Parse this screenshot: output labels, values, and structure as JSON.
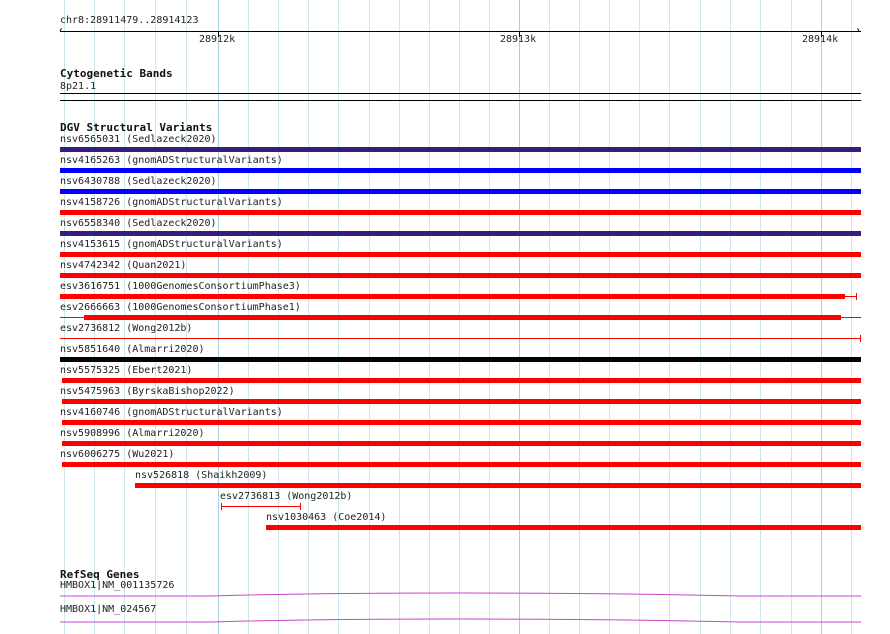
{
  "ruler": {
    "location": "chr8:28911479..28914123",
    "ticks": [
      "28912k",
      "28913k",
      "28914k"
    ]
  },
  "cytobands": {
    "title": "Cytogenetic Bands",
    "band": "8p21.1"
  },
  "dgv": {
    "title": "DGV Structural Variants",
    "colors": {
      "purple": "#3a1c7a",
      "blue": "#0000ff",
      "red": "#ff0000",
      "black": "#000000"
    },
    "variants": [
      {
        "label": "nsv6565031 (Sedlazeck2020)",
        "color": "#3a1c7a"
      },
      {
        "label": "nsv4165263 (gnomADStructuralVariants)",
        "color": "#0000ff"
      },
      {
        "label": "nsv6430788 (Sedlazeck2020)",
        "color": "#0000ff"
      },
      {
        "label": "nsv4158726 (gnomADStructuralVariants)",
        "color": "#ff0000"
      },
      {
        "label": "nsv6558340 (Sedlazeck2020)",
        "color": "#3a1c7a"
      },
      {
        "label": "nsv4153615 (gnomADStructuralVariants)",
        "color": "#ff0000"
      },
      {
        "label": "nsv4742342 (Quan2021)",
        "color": "#ff0000"
      },
      {
        "label": "esv3616751 (1000GenomesConsortiumPhase3)",
        "color": "#ff0000"
      },
      {
        "label": "esv2666663 (1000GenomesConsortiumPhase1)",
        "color": "#ff0000"
      },
      {
        "label": "esv2736812 (Wong2012b)",
        "color": "#ff0000"
      },
      {
        "label": "nsv5851640 (Almarri2020)",
        "color": "#000000"
      },
      {
        "label": "nsv5575325 (Ebert2021)",
        "color": "#ff0000"
      },
      {
        "label": "nsv5475963 (ByrskaBishop2022)",
        "color": "#ff0000"
      },
      {
        "label": "nsv4160746 (gnomADStructuralVariants)",
        "color": "#ff0000"
      },
      {
        "label": "nsv5908996 (Almarri2020)",
        "color": "#ff0000"
      },
      {
        "label": "nsv6006275 (Wu2021)",
        "color": "#ff0000"
      },
      {
        "label": "nsv526818 (Shaikh2009)",
        "color": "#ff0000"
      },
      {
        "label": "esv2736813 (Wong2012b)",
        "color": "#ff0000"
      },
      {
        "label": "nsv1030463 (Coe2014)",
        "color": "#ff0000"
      }
    ]
  },
  "refseq": {
    "title": "RefSeq Genes",
    "color": "#cc44cc",
    "genes": [
      {
        "label": "HMBOX1|NM_001135726"
      },
      {
        "label": "HMBOX1|NM_024567"
      }
    ]
  }
}
